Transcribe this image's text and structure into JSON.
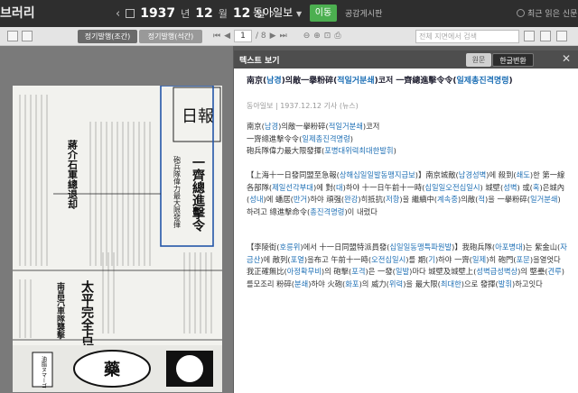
{
  "app": {
    "brand": "브러리"
  },
  "nav": {
    "year": "1937",
    "month": "12",
    "day": "12",
    "year_suffix": "년",
    "month_suffix": "월",
    "day_suffix": "일",
    "paper": "동아일보",
    "go": "이동",
    "share": "공감게시판",
    "recent": "최근 읽은 신문"
  },
  "toolbar": {
    "tab_a": "정기발행(조간)",
    "tab_b": "정기발행(석간)",
    "page_current": "1",
    "page_total": "/ 8",
    "search_placeholder": "전체 지면에서 검색"
  },
  "panel": {
    "title": "텍스트 보기",
    "original": "원문",
    "hangul": "한글변환"
  },
  "article": {
    "title_a": "南京(",
    "title_a_hl": "남경",
    "title_b": ")의敵一擧粉碎(",
    "title_b_hl": "적일거분쇄",
    "title_c": ")코저 一齊總進擊令令(",
    "title_c_hl": "일제총진격명령",
    "title_d": ")",
    "meta": "동아일보 | 1937.12.12 기사 (뉴스)",
    "lines": [
      {
        "parts": [
          [
            "南京(",
            0
          ],
          [
            "남경",
            1
          ],
          [
            ")의敵一擧粉碎(",
            0
          ],
          [
            "적일거분쇄",
            1
          ],
          [
            ")코저",
            0
          ]
        ]
      },
      {
        "parts": [
          [
            "一齊總進擊令令(",
            0
          ],
          [
            "일제총진격명령",
            1
          ],
          [
            ")",
            0
          ]
        ]
      },
      {
        "parts": [
          [
            "砲兵隊偉力最大限發揮(",
            0
          ],
          [
            "포병대위력최대한발휘",
            1
          ],
          [
            ")",
            0
          ]
        ]
      }
    ],
    "para1": [
      [
        "【上海十一日發同盟至急報(",
        0
      ],
      [
        "상해십일일발동맹지급보",
        1
      ],
      [
        ")】南京城敵(",
        0
      ],
      [
        "남경성벽",
        1
      ],
      [
        ")에 殺到(",
        0
      ],
      [
        "쇄도",
        1
      ],
      [
        ")한 第一線各部隊(",
        0
      ],
      [
        "제일선각부대",
        1
      ],
      [
        ")에 對(",
        0
      ],
      [
        "대",
        1
      ],
      [
        ")하야 十一日午前十一時(",
        0
      ],
      [
        "십일일오전십일시",
        1
      ],
      [
        ") 城壁(",
        0
      ],
      [
        "성벽",
        1
      ],
      [
        ") 或(",
        0
      ],
      [
        "혹",
        1
      ],
      [
        ")은城內(",
        0
      ],
      [
        "성내",
        1
      ],
      [
        ")에 蟠居(",
        0
      ],
      [
        "반거",
        1
      ],
      [
        ")하야 頑强(",
        0
      ],
      [
        "완강",
        1
      ],
      [
        ")히抵抗(",
        0
      ],
      [
        "저항",
        1
      ],
      [
        ")을 繼續中(",
        0
      ],
      [
        "계속중",
        1
      ],
      [
        ")의敵(",
        0
      ],
      [
        "적",
        1
      ],
      [
        ")을 一擧粉碎(",
        0
      ],
      [
        "일거분쇄",
        1
      ],
      [
        ")하려고 總進擊命令(",
        0
      ],
      [
        "총진격명령",
        1
      ],
      [
        ")이 내렸다",
        0
      ]
    ],
    "para2": [
      [
        "【李陵街(",
        0
      ],
      [
        "호릉위",
        1
      ],
      [
        ")에서 十一日同盟特派員發(",
        0
      ],
      [
        "십일일동맹특파원발",
        1
      ],
      [
        ")】我砲兵隊(",
        0
      ],
      [
        "아포병대",
        1
      ],
      [
        ")는 紫金山(",
        0
      ],
      [
        "자금산",
        1
      ],
      [
        ")에 敵列(",
        0
      ],
      [
        "포열",
        1
      ],
      [
        ")을布고 午前十一時(",
        0
      ],
      [
        "오전십일시",
        1
      ],
      [
        ")를 期(",
        0
      ],
      [
        "기",
        1
      ],
      [
        ")하야 一齊(",
        0
      ],
      [
        "일제",
        1
      ],
      [
        ")히 砲門(",
        0
      ],
      [
        "포문",
        1
      ],
      [
        ")을열엇다 我正確無比(",
        0
      ],
      [
        "아정확무비",
        1
      ],
      [
        ")의 砲擊(",
        0
      ],
      [
        "포격",
        1
      ],
      [
        ")은 一發(",
        0
      ],
      [
        "일발",
        1
      ],
      [
        ")마다 城壁及城壁上(",
        0
      ],
      [
        "성벽급성벽상",
        1
      ],
      [
        ")의 堅壘(",
        0
      ],
      [
        "견루",
        1
      ],
      [
        ")를모조리 粉碎(",
        0
      ],
      [
        "분쇄",
        1
      ],
      [
        ")하야 火砲(",
        0
      ],
      [
        "화포",
        1
      ],
      [
        ")의 威力(",
        0
      ],
      [
        "위력",
        1
      ],
      [
        ")을 最大限(",
        0
      ],
      [
        "최대한",
        1
      ],
      [
        ")으로 發揮(",
        0
      ],
      [
        "발휘",
        1
      ],
      [
        ")하고잇다",
        0
      ]
    ]
  },
  "newspaper": {
    "masthead": "日報",
    "headline_1": "一齊總進擊令",
    "headline_2": "砲兵隊偉力最大限發揮",
    "left_head_1": "蔣介石軍總退却",
    "left_head_2": "太平完全占領",
    "left_head_3": "南昌汽車隊襲擊",
    "ad_text": "藥",
    "ad_text_2": "油脂ヌマーゴ"
  },
  "colors": {
    "accent": "#1d6fb5",
    "go": "#4caf50"
  }
}
